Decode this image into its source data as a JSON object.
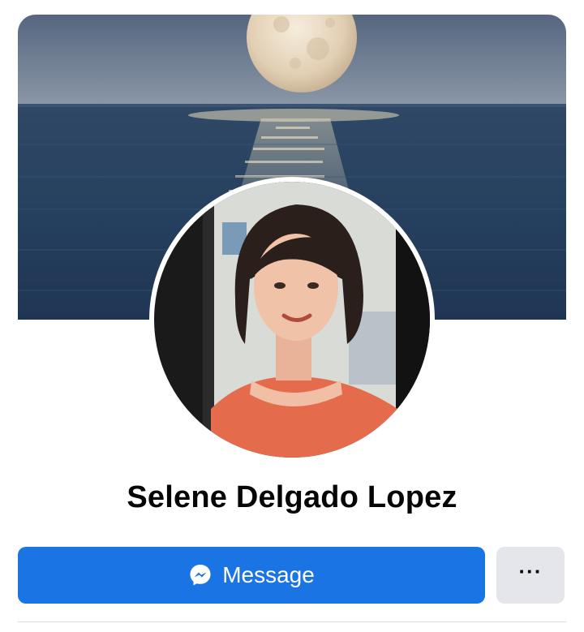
{
  "profile": {
    "name": "Selene Delgado Lopez"
  },
  "actions": {
    "message_label": "Message",
    "more_label": "···"
  },
  "icons": {
    "message": "messenger-icon",
    "more": "more-options-icon"
  },
  "colors": {
    "primary_button": "#1b74e4",
    "secondary_button": "#e4e6eb",
    "name_text": "#050505"
  }
}
